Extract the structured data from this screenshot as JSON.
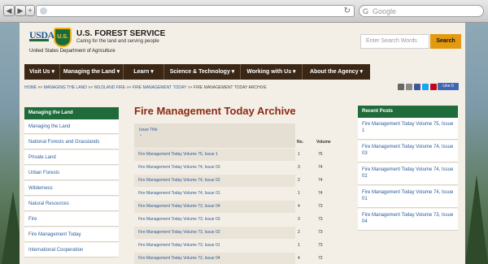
{
  "browser": {
    "back_icon": "◀",
    "forward_icon": "▶",
    "add_icon": "+",
    "reload_icon": "↻",
    "search_engine_glyph": "G",
    "search_placeholder": "Google"
  },
  "header": {
    "usda": "USDA",
    "shield_text": "U.S.",
    "agency_title": "U.S. FOREST SERVICE",
    "tagline": "Caring for the land and serving people",
    "department": "United States Department of Agriculture",
    "search_placeholder": "Enter Search Words",
    "search_button": "Search"
  },
  "nav": {
    "items": [
      {
        "label": "Visit Us ▾"
      },
      {
        "label": "Managing the Land ▾"
      },
      {
        "label": "Learn ▾"
      },
      {
        "label": "Science & Technology ▾"
      },
      {
        "label": "Working with Us ▾"
      },
      {
        "label": "About the Agency ▾"
      }
    ]
  },
  "breadcrumb": {
    "home": "HOME",
    "sep": " >> ",
    "l1": "MANAGING THE LAND",
    "l2": "WILDLAND FIRE",
    "l3": "FIRE MANAGEMENT TODAY",
    "current": "FIRE MANAGEMENT TODAY ARCHIVE"
  },
  "share": {
    "like_label": "Like 0",
    "icons": [
      "email-icon",
      "print-icon",
      "facebook-icon",
      "twitter-icon",
      "pinterest-icon",
      "share-icon"
    ]
  },
  "sidebar": {
    "heading": "Managing the Land",
    "items": [
      {
        "label": "Managing the Land"
      },
      {
        "label": "National Forests and Grasslands"
      },
      {
        "label": "Private Land"
      },
      {
        "label": "Urban Forests"
      },
      {
        "label": "Wilderness"
      },
      {
        "label": "Natural Resources"
      },
      {
        "label": "Fire"
      },
      {
        "label": "Fire Management Today"
      },
      {
        "label": "International Cooperation"
      }
    ]
  },
  "main": {
    "title": "Fire Management Today Archive",
    "columns": {
      "issue": "Issue Title",
      "sort": "▼",
      "no": "No.",
      "volume": "Volume"
    },
    "rows": [
      {
        "title": "Fire Management Today Volume 75, Issue 1",
        "no": "1",
        "volume": "75"
      },
      {
        "title": "Fire Management Today Volume 74, Issue 03",
        "no": "3",
        "volume": "74"
      },
      {
        "title": "Fire Management Today Volume 74, Issue 02",
        "no": "2",
        "volume": "74"
      },
      {
        "title": "Fire Management Today Volume 74, Issue 01",
        "no": "1",
        "volume": "74"
      },
      {
        "title": "Fire Management Today Volume 73, Issue 04",
        "no": "4",
        "volume": "73"
      },
      {
        "title": "Fire Management Today Volume 73, Issue 03",
        "no": "3",
        "volume": "73"
      },
      {
        "title": "Fire Management Today Volume 73, Issue 02",
        "no": "2",
        "volume": "73"
      },
      {
        "title": "Fire Management Today Volume 73, Issue 01",
        "no": "1",
        "volume": "73"
      },
      {
        "title": "Fire Management Today Volume 72, Issue 04",
        "no": "4",
        "volume": "72"
      }
    ]
  },
  "recent": {
    "heading": "Recent Posts",
    "items": [
      {
        "label": "Fire Management Today Volume 75, Issue 1"
      },
      {
        "label": "Fire Management Today Volume 74, Issue 03"
      },
      {
        "label": "Fire Management Today Volume 74, Issue 02"
      },
      {
        "label": "Fire Management Today Volume 74, Issue 01"
      },
      {
        "label": "Fire Management Today Volume 73, Issue 04"
      }
    ]
  },
  "colors": {
    "forest_green": "#1f6b3a",
    "nav_brown": "#3b2716",
    "title_red": "#8c2a12",
    "search_orange": "#e49a10",
    "link_blue": "#2d5c9a"
  }
}
